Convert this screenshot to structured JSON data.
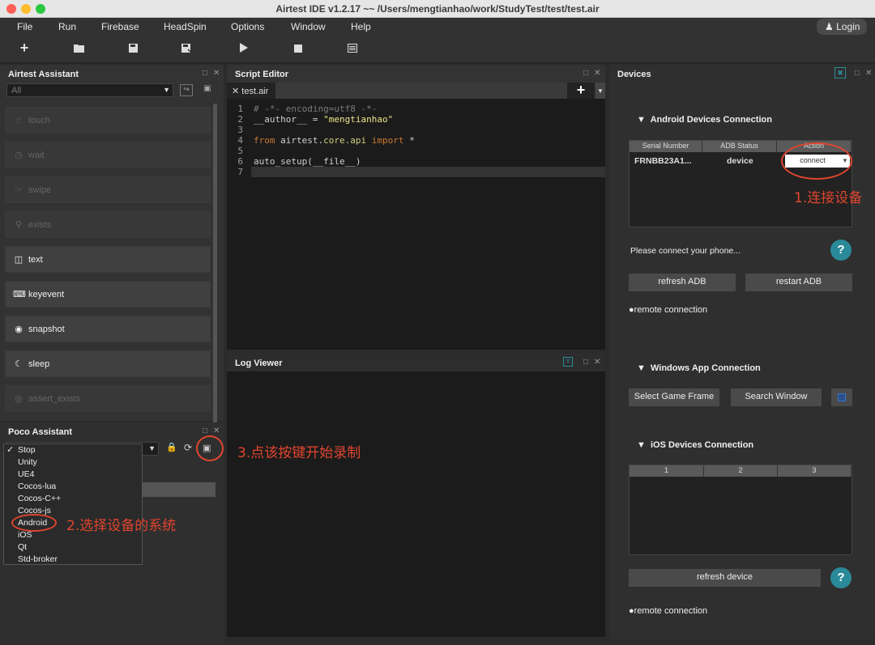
{
  "window": {
    "title": "Airtest IDE v1.2.17 ~~ /Users/mengtianhao/work/StudyTest/test/test.air"
  },
  "menu": {
    "items": [
      "File",
      "Run",
      "Firebase",
      "HeadSpin",
      "Options",
      "Window",
      "Help"
    ],
    "login": "Login"
  },
  "toolbar": {
    "icons": [
      "plus-icon",
      "folder-open-icon",
      "save-icon",
      "save-as-icon",
      "run-icon",
      "stop-icon",
      "log-icon"
    ]
  },
  "airtest_assistant": {
    "title": "Airtest Assistant",
    "filter": "All",
    "buttons": [
      {
        "label": "touch",
        "enabled": false
      },
      {
        "label": "wait",
        "enabled": false
      },
      {
        "label": "swipe",
        "enabled": false
      },
      {
        "label": "exists",
        "enabled": false
      },
      {
        "label": "text",
        "enabled": true
      },
      {
        "label": "keyevent",
        "enabled": true
      },
      {
        "label": "snapshot",
        "enabled": true
      },
      {
        "label": "sleep",
        "enabled": true
      },
      {
        "label": "assert_exists",
        "enabled": false
      }
    ]
  },
  "poco_assistant": {
    "title": "Poco Assistant",
    "options": [
      "Stop",
      "Unity",
      "UE4",
      "Cocos-lua",
      "Cocos-C++",
      "Cocos-js",
      "Android",
      "iOS",
      "Qt",
      "Std-broker"
    ],
    "selected": "Stop",
    "highlighted": "Android"
  },
  "script_editor": {
    "title": "Script Editor",
    "tab": "test.air",
    "line_numbers": [
      "1",
      "2",
      "3",
      "4",
      "5",
      "6",
      "7"
    ]
  },
  "log_viewer": {
    "title": "Log Viewer"
  },
  "devices": {
    "title": "Devices",
    "android": {
      "title": "Android Devices Connection",
      "columns": [
        "Serial Number",
        "ADB Status",
        "Action"
      ],
      "rows": [
        {
          "serial": "FRNBB23A1...",
          "status": "device",
          "action": "connect"
        }
      ],
      "hint": "Please connect your phone...",
      "refresh_adb": "refresh ADB",
      "restart_adb": "restart ADB",
      "remote": "remote connection"
    },
    "windows": {
      "title": "Windows App Connection",
      "select_frame": "Select Game Frame",
      "search_window": "Search Window"
    },
    "ios": {
      "title": "iOS Devices Connection",
      "columns": [
        "1",
        "2",
        "3"
      ],
      "refresh": "refresh device",
      "remote": "remote connection"
    },
    "help": "?"
  },
  "annotations": {
    "step1": "1.连接设备",
    "step2": "2.选择设备的系统",
    "step3": "3.点该按键开始录制",
    "accent": "#e0452f"
  }
}
